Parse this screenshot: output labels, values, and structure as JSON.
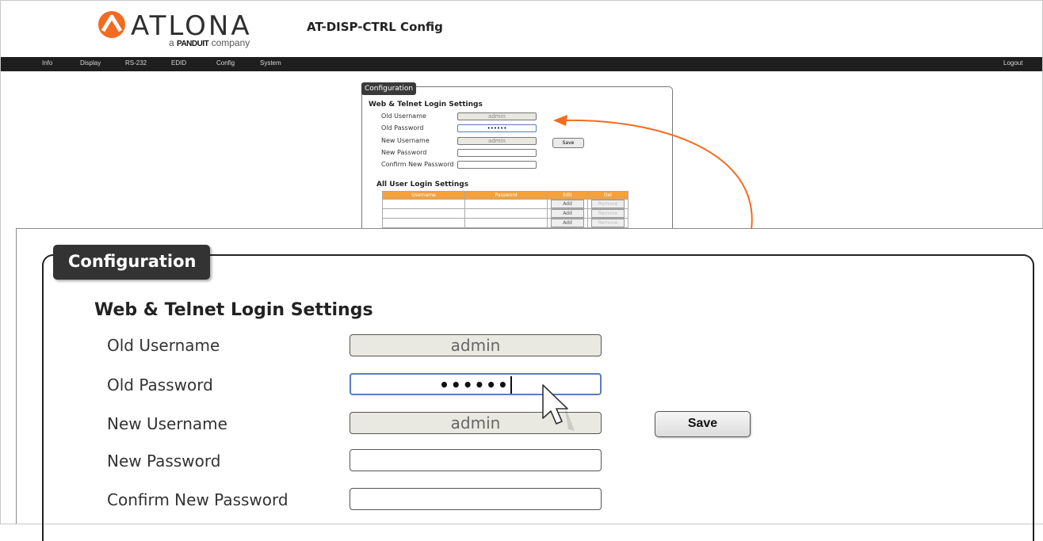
{
  "brand": {
    "name": "ATLONA",
    "tagline_prefix": "a",
    "tagline_brand": "PANDUIT",
    "tagline_suffix": "company"
  },
  "page_title": "AT-DISP-CTRL  Config",
  "nav": {
    "items": [
      "Info",
      "Display",
      "RS-232",
      "EDID",
      "Config",
      "System"
    ],
    "logout": "Logout"
  },
  "config": {
    "legend": "Configuration",
    "web_section_title": "Web & Telnet Login Settings",
    "fields": {
      "old_username": {
        "label": "Old Username",
        "value": "admin"
      },
      "old_password": {
        "label": "Old Password",
        "value": "••••••"
      },
      "new_username": {
        "label": "New Username",
        "value": "admin"
      },
      "new_password": {
        "label": "New Password",
        "value": ""
      },
      "confirm_password": {
        "label": "Confirm New Password",
        "value": ""
      }
    },
    "save_label": "Save",
    "user_section_title": "All User Login Settings",
    "user_table": {
      "columns": [
        "Username",
        "Password",
        "Edit",
        "Del"
      ],
      "add_label": "Add",
      "remove_label": "Remove"
    }
  },
  "colors": {
    "accent": "#f26b21",
    "table_header": "#f3a13d",
    "navbar": "#1e1e1e"
  }
}
